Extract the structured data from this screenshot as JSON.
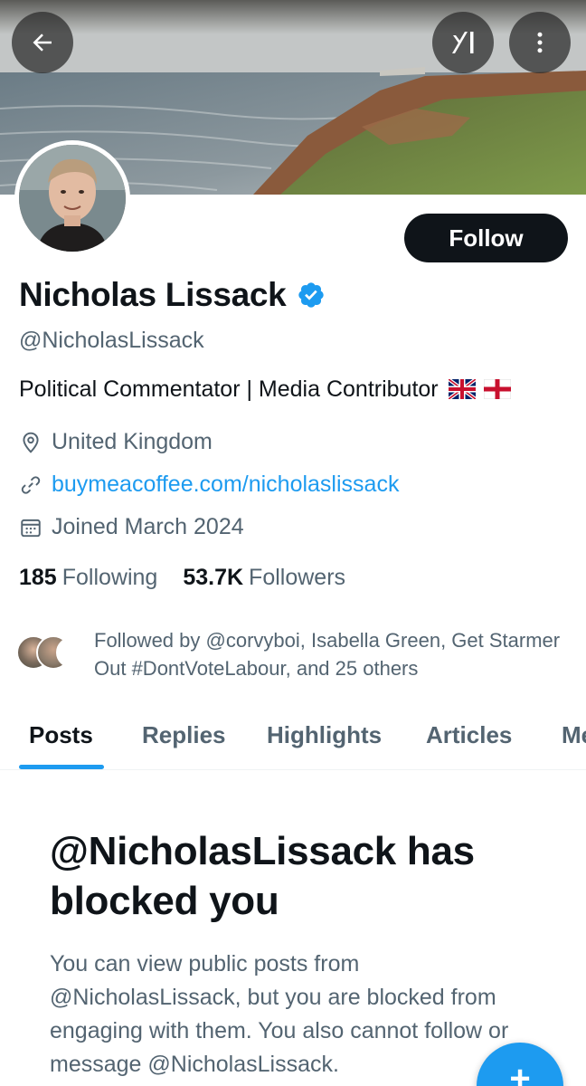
{
  "header": {
    "back_icon": "arrow-left-icon",
    "grok_icon": "grok-icon",
    "more_icon": "more-vertical-icon"
  },
  "profile": {
    "name": "Nicholas Lissack",
    "verified": true,
    "handle": "@NicholasLissack",
    "bio": "Political Commentator | Media Contributor",
    "location": "United Kingdom",
    "website": "buymeacoffee.com/nicholaslissack",
    "joined": "Joined March 2024",
    "following_count": "185",
    "following_label": "Following",
    "followers_count": "53.7K",
    "followers_label": "Followers",
    "follow_label": "Follow",
    "followed_by": "Followed by @corvyboi, Isabella Green, Get Starmer Out #DontVoteLabour, and 25 others"
  },
  "tabs": [
    {
      "label": "Posts",
      "active": true
    },
    {
      "label": "Replies",
      "active": false
    },
    {
      "label": "Highlights",
      "active": false
    },
    {
      "label": "Articles",
      "active": false
    },
    {
      "label": "Me",
      "active": false
    }
  ],
  "blocked": {
    "title": "@NicholasLissack has blocked you",
    "body": "You can view public posts from @NicholasLissack, but you are blocked from engaging with them. You also cannot follow or message @NicholasLissack."
  },
  "colors": {
    "accent": "#1d9bf0",
    "text_primary": "#0f1419",
    "text_secondary": "#536471",
    "button_dark": "#0f1419"
  },
  "fab": {
    "icon": "plus-icon"
  }
}
